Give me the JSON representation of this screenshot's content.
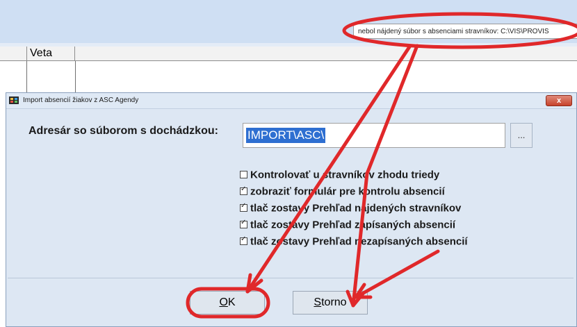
{
  "background": {
    "grid_column_header": "Veta"
  },
  "tooltip": {
    "text": "nebol nájdený súbor s absenciami stravníkov: C:\\VIS\\PROVIS"
  },
  "dialog": {
    "title": "Import absencií žiakov z ASC Agendy",
    "close_label": "x",
    "dir_label": "Adresár so súborom s dochádzkou:",
    "dir_value": "IMPORT\\ASC\\",
    "browse_label": "...",
    "options": [
      {
        "label": "Kontrolovať u stravníkov zhodu triedy",
        "checked": false
      },
      {
        "label": "zobraziť formulár pre kontrolu absencií",
        "checked": true
      },
      {
        "label": "tlač zostavy Prehľad nájdených stravníkov",
        "checked": true
      },
      {
        "label": "tlač zostavy Prehľad zapísaných absencií",
        "checked": true
      },
      {
        "label": "tlač zostavy Prehľad nezapísaných absencií",
        "checked": true
      }
    ],
    "ok": {
      "accel": "O",
      "rest": "K"
    },
    "storno": {
      "accel": "S",
      "rest": "torno"
    }
  },
  "colors": {
    "annotation": "#e0282a",
    "selection": "#2e6fd1",
    "dialog_bg": "#dde7f3"
  }
}
